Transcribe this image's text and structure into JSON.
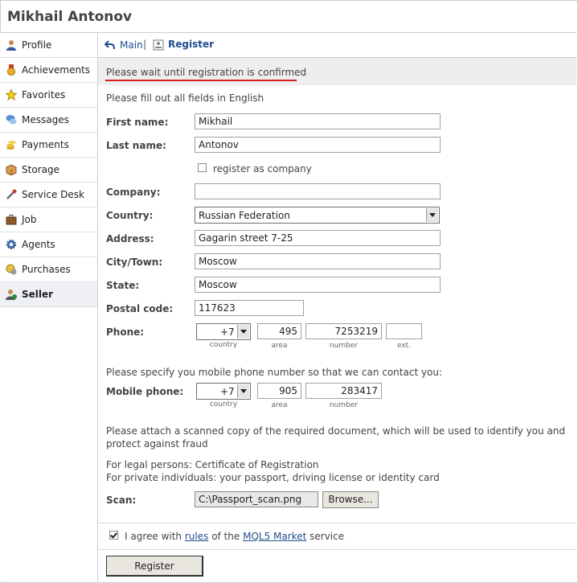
{
  "page": {
    "title": "Mikhail Antonov"
  },
  "sidebar": {
    "items": [
      {
        "label": "Profile",
        "icon": "user-icon"
      },
      {
        "label": "Achievements",
        "icon": "medal-icon"
      },
      {
        "label": "Favorites",
        "icon": "star-icon"
      },
      {
        "label": "Messages",
        "icon": "chat-icon"
      },
      {
        "label": "Payments",
        "icon": "coins-icon"
      },
      {
        "label": "Storage",
        "icon": "box-icon"
      },
      {
        "label": "Service Desk",
        "icon": "tools-icon"
      },
      {
        "label": "Job",
        "icon": "briefcase-icon"
      },
      {
        "label": "Agents",
        "icon": "gear-icon"
      },
      {
        "label": "Purchases",
        "icon": "purchase-icon"
      },
      {
        "label": "Seller",
        "icon": "seller-icon"
      }
    ],
    "active": "Seller"
  },
  "breadcrumb": {
    "main": "Main",
    "separator": "|",
    "current": "Register"
  },
  "notice": "Please wait until registration is confirmed",
  "form": {
    "intro": "Please fill out all fields in English",
    "first_name": {
      "label": "First name:",
      "value": "Mikhail"
    },
    "last_name": {
      "label": "Last name:",
      "value": "Antonov"
    },
    "company_checkbox": {
      "label": "register as company",
      "checked": false
    },
    "company": {
      "label": "Company:",
      "value": ""
    },
    "country": {
      "label": "Country:",
      "value": "Russian Federation"
    },
    "address": {
      "label": "Address:",
      "value": "Gagarin street 7-25"
    },
    "city": {
      "label": "City/Town:",
      "value": "Moscow"
    },
    "state": {
      "label": "State:",
      "value": "Moscow"
    },
    "postal": {
      "label": "Postal code:",
      "value": "117623"
    },
    "phone": {
      "label": "Phone:",
      "country": "+7",
      "area": "495",
      "number": "7253219",
      "ext": "",
      "hint_country": "country",
      "hint_area": "area",
      "hint_number": "number",
      "hint_ext": "ext."
    },
    "mobile_prompt": "Please specify you mobile phone number so that we can contact you:",
    "mobile": {
      "label": "Mobile phone:",
      "country": "+7",
      "area": "905",
      "number": "283417",
      "hint_country": "country",
      "hint_area": "area",
      "hint_number": "number"
    },
    "scan_text_1": "Please attach a scanned copy of the required document, which will be used to identify you and",
    "scan_text_2": "protect against fraud",
    "legal_text": "For legal persons: Certificate of Registration",
    "private_text": "For private individuals: your passport, driving license or identity card",
    "scan": {
      "label": "Scan:",
      "value": "C:\\Passport_scan.png",
      "browse": "Browse..."
    },
    "agree": {
      "checked": true,
      "text_before": "I agree with",
      "rules": "rules",
      "text_mid": "of the",
      "market": "MQL5 Market",
      "text_after": "service"
    },
    "submit": "Register"
  }
}
